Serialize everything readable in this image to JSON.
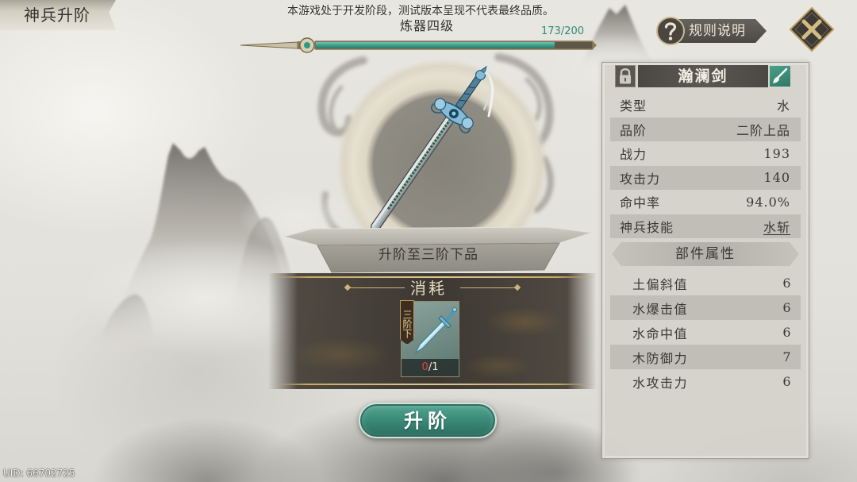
{
  "screen": {
    "title": "神兵升阶",
    "notice": "本游戏处于开发阶段，测试版本呈现不代表最终品质。",
    "uid": "UID: 66702725"
  },
  "refine": {
    "level_label": "炼器四级",
    "progress_text": "173/200",
    "current": 173,
    "max": 200
  },
  "rules_button": {
    "label": "规则说明",
    "icon": "question-mark-icon"
  },
  "close_button": {
    "icon": "close-x-icon"
  },
  "weapon": {
    "name": "瀚澜剑",
    "lock_icon": "lock-icon",
    "edit_icon": "brush-icon",
    "image": "sword-illustration",
    "stats": [
      {
        "label": "类型",
        "value": "水"
      },
      {
        "label": "品阶",
        "value": "二阶上品"
      },
      {
        "label": "战力",
        "value": "193"
      },
      {
        "label": "攻击力",
        "value": "140"
      },
      {
        "label": "命中率",
        "value": "94.0%"
      }
    ],
    "skill": {
      "label": "神兵技能",
      "value": "水斩"
    },
    "parts_header": "部件属性",
    "parts": [
      {
        "label": "土偏斜值",
        "value": "6"
      },
      {
        "label": "水爆击值",
        "value": "6"
      },
      {
        "label": "水命中值",
        "value": "6"
      },
      {
        "label": "木防御力",
        "value": "7"
      },
      {
        "label": "水攻击力",
        "value": "6"
      }
    ]
  },
  "upgrade": {
    "target_label": "升阶至三阶下品",
    "cost_header": "消耗",
    "cost_item": {
      "grade_tag": "三阶下",
      "owned": "0",
      "required": "/1",
      "icon": "sword-icon"
    },
    "button_label": "升阶"
  },
  "colors": {
    "accent_teal": "#2f8a78",
    "progress_fill": "#3fa08c",
    "insufficient_red": "#e0473a"
  }
}
